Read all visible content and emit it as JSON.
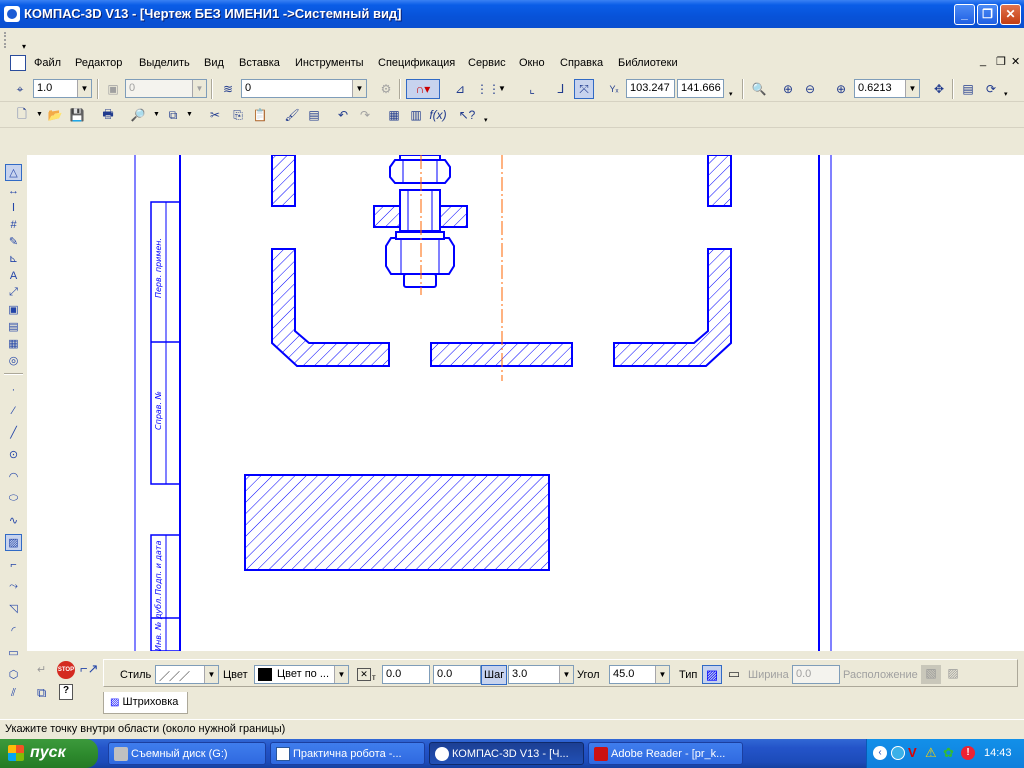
{
  "window": {
    "title": "КОМПАС-3D V13 - [Чертеж БЕЗ ИМЕНИ1 ->Системный вид]"
  },
  "menu": [
    "Файл",
    "Редактор",
    "Выделить",
    "Вид",
    "Вставка",
    "Инструменты",
    "Спецификация",
    "Сервис",
    "Окно",
    "Справка",
    "Библиотеки"
  ],
  "toolbar": {
    "scale_value": "1.0",
    "layer_state_value": "0",
    "layer_value": "0",
    "coord_x": "103.247",
    "coord_y": "141.666",
    "zoom_value": "0.6213"
  },
  "drawing": {
    "frame_labels": [
      "Перв. примен.",
      "Справ. №",
      "Подп. и дата",
      "Инв. № дубл."
    ],
    "colors": {
      "line": "#0000ff",
      "axis": "#ff6600"
    }
  },
  "props": {
    "style_label": "Стиль",
    "color_label": "Цвет",
    "color_value": "Цвет по ...",
    "coord1": "0.0",
    "coord2": "0.0",
    "step_label": "Шаг",
    "step_value": "3.0",
    "angle_label": "Угол",
    "angle_value": "45.0",
    "type_label": "Тип",
    "width_label": "Ширина",
    "width_value": "0.0",
    "layout_label": "Расположение",
    "tab_label": "Штриховка"
  },
  "status": {
    "text": "Укажите точку внутри области (около нужной границы)"
  },
  "taskbar": {
    "start_label": "пуск",
    "tasks": [
      "Съемный диск (G:)",
      "Практична робота -...",
      "КОМПАС-3D V13 - [Ч...",
      "Adobe Reader - [pr_k..."
    ],
    "clock": "14:43"
  }
}
